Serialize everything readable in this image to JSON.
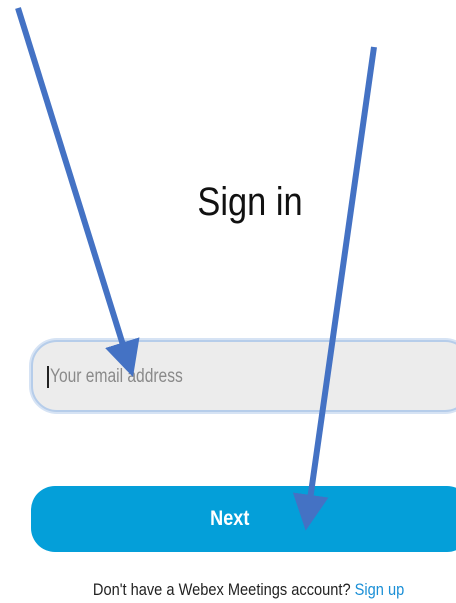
{
  "page": {
    "title": "Sign in"
  },
  "email": {
    "placeholder": "Your email address",
    "value": ""
  },
  "next_button": {
    "label": "Next"
  },
  "footer": {
    "prompt": "Don't have a Webex Meetings account?",
    "signup_label": "Sign up"
  },
  "annotations": {
    "arrow_color": "#4472c4"
  }
}
